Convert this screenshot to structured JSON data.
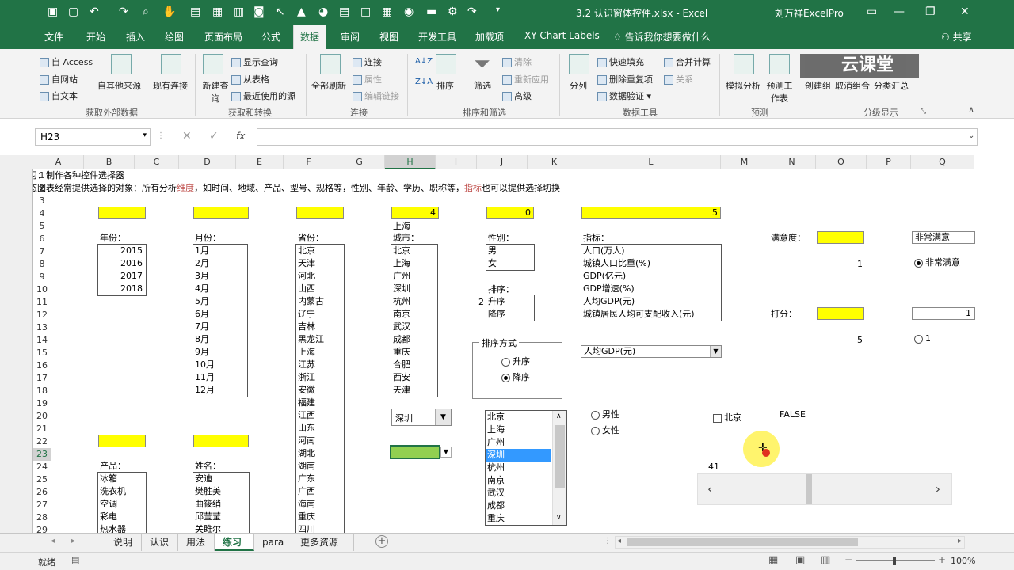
{
  "window": {
    "title": "3.2 认识窗体控件.xlsx - Excel",
    "user": "刘万祥ExcelPro"
  },
  "tabs": [
    "文件",
    "开始",
    "插入",
    "绘图",
    "页面布局",
    "公式",
    "数据",
    "审阅",
    "视图",
    "开发工具",
    "加载项",
    "XY Chart Labels"
  ],
  "tell_me": "告诉我你想要做什么",
  "share": "共享",
  "ribbon": {
    "g1": {
      "access": "自 Access",
      "web": "自网站",
      "text": "自文本",
      "other": "自其他来源",
      "existing": "现有连接",
      "label": "获取外部数据"
    },
    "g2": {
      "newq": "新建查询",
      "show": "显示查询",
      "table": "从表格",
      "recent": "最近使用的源",
      "label": "获取和转换"
    },
    "g3": {
      "refresh": "全部刷新",
      "conn": "连接",
      "prop": "属性",
      "edit": "编辑链接",
      "label": "连接"
    },
    "g4": {
      "sort": "排序",
      "filter": "筛选",
      "clear": "清除",
      "reapply": "重新应用",
      "adv": "高级",
      "label": "排序和筛选"
    },
    "g5": {
      "split": "分列",
      "flash": "快速填充",
      "dedup": "删除重复项",
      "valid": "数据验证",
      "merge": "合并计算",
      "rel": "关系",
      "label": "数据工具"
    },
    "g6": {
      "whatif": "模拟分析",
      "forecast": "预测工作表",
      "label": "预测"
    },
    "g7": {
      "group": "创建组",
      "ungroup": "取消组合",
      "subtotal": "分类汇总",
      "label": "分级显示"
    },
    "watermark": "云课堂"
  },
  "formula_bar": {
    "namebox": "H23",
    "fx": "fx",
    "content": ""
  },
  "columns": [
    "A",
    "B",
    "C",
    "D",
    "E",
    "F",
    "G",
    "H",
    "I",
    "J",
    "K",
    "L",
    "M",
    "N",
    "O",
    "P",
    "Q"
  ],
  "rows": [
    "1",
    "2",
    "3",
    "4",
    "5",
    "6",
    "7",
    "8",
    "9",
    "10",
    "11",
    "12",
    "13",
    "14",
    "15",
    "16",
    "17",
    "18",
    "19",
    "20",
    "21",
    "22",
    "23",
    "24",
    "25",
    "26",
    "27",
    "28",
    "29"
  ],
  "sheet": {
    "a1": "练习：制作各种控件选择器",
    "a2_1": "动态图表经常提供选择的对象：所有分析",
    "a2_dim": "维度",
    "a2_2": "，如时间、地域、产品、型号、规格等，性别、年龄、学历、职称等，",
    "a2_ind": "指标",
    "a2_3": "也可以提供选择切换",
    "h4": "4",
    "j4": "0",
    "l4": "5",
    "year_label": "年份：",
    "years": [
      "2015",
      "2016",
      "2017",
      "2018"
    ],
    "month_label": "月份：",
    "months": [
      "1月",
      "2月",
      "3月",
      "4月",
      "5月",
      "6月",
      "7月",
      "8月",
      "9月",
      "10月",
      "11月",
      "12月"
    ],
    "prov_label": "省份：",
    "provinces": [
      "北京",
      "天津",
      "河北",
      "山西",
      "内蒙古",
      "辽宁",
      "吉林",
      "黑龙江",
      "上海",
      "江苏",
      "浙江",
      "安徽",
      "福建",
      "江西",
      "山东",
      "河南",
      "湖北",
      "湖南",
      "广东",
      "广西",
      "海南",
      "重庆",
      "四川"
    ],
    "h5": "上海",
    "city_label": "城市：",
    "cities": [
      "北京",
      "上海",
      "广州",
      "深圳",
      "杭州",
      "南京",
      "武汉",
      "成都",
      "重庆",
      "合肥",
      "西安",
      "天津"
    ],
    "gender_label": "性别：",
    "genders": [
      "男",
      "女"
    ],
    "sort_label": "排序：",
    "sorts": [
      "升序",
      "降序"
    ],
    "i11": "2",
    "sort_group": "排序方式",
    "sort_asc": "升序",
    "sort_desc": "降序",
    "ind_label": "指标：",
    "indicators": [
      "人口(万人)",
      "城镇人口比重(%)",
      "GDP(亿元)",
      "GDP增速(%)",
      "人均GDP(元)",
      "城镇居民人均可支配收入(元)"
    ],
    "ind_dropdown": "人均GDP(元)",
    "sat_label": "满意度：",
    "o8": "1",
    "sat_dropdown": "非常满意",
    "sat_radio": "非常满意",
    "score_label": "打分：",
    "o14": "5",
    "q12": "1",
    "q14_radio": "1",
    "city_combo": "深圳",
    "city_list2": [
      "北京",
      "上海",
      "广州",
      "深圳",
      "杭州",
      "南京",
      "武汉",
      "成都",
      "重庆"
    ],
    "male": "男性",
    "female": "女性",
    "chk_beijing": "北京",
    "false_val": "FALSE",
    "n24": "41",
    "prod_label": "产品：",
    "products": [
      "冰箱",
      "洗衣机",
      "空调",
      "彩电",
      "热水器"
    ],
    "name_label": "姓名：",
    "names": [
      "安迪",
      "樊胜美",
      "曲筱绡",
      "邱莹莹",
      "关雎尔"
    ]
  },
  "sheet_tabs": [
    "说明",
    "认识",
    "用法",
    "练习",
    "para",
    "更多资源"
  ],
  "active_sheet": "练习",
  "status": {
    "ready": "就绪",
    "zoom": "100%"
  }
}
